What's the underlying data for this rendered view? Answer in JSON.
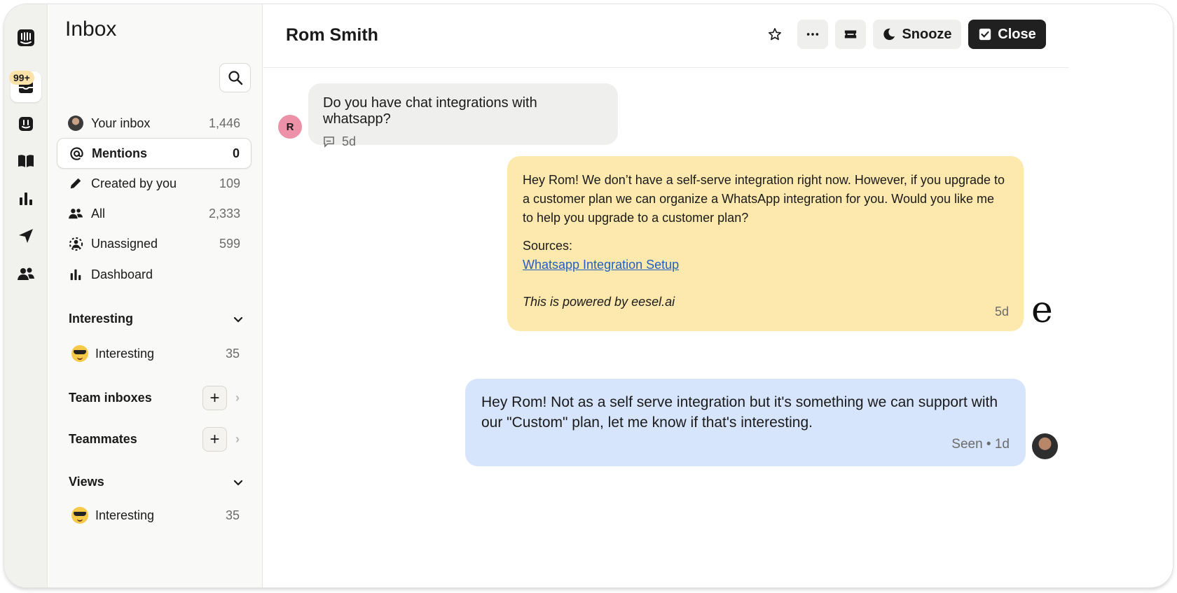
{
  "rail": {
    "badge": "99+",
    "items": [
      "intercom-logo-icon",
      "inbox-icon",
      "fin-icon",
      "knowledge-icon",
      "reports-icon",
      "outbound-icon",
      "contacts-icon"
    ]
  },
  "sidebar": {
    "title": "Inbox",
    "nav": [
      {
        "label": "Your inbox",
        "count": "1,446",
        "icon": "avatar"
      },
      {
        "label": "Mentions",
        "count": "0",
        "icon": "at-icon"
      },
      {
        "label": "Created by you",
        "count": "109",
        "icon": "pencil-icon"
      },
      {
        "label": "All",
        "count": "2,333",
        "icon": "people-icon"
      },
      {
        "label": "Unassigned",
        "count": "599",
        "icon": "unassigned-icon"
      },
      {
        "label": "Dashboard",
        "count": "",
        "icon": "bar-chart-icon"
      }
    ],
    "interesting_section": {
      "label": "Interesting",
      "item": {
        "label": "Interesting",
        "count": "35"
      }
    },
    "team_inboxes": {
      "label": "Team inboxes"
    },
    "teammates": {
      "label": "Teammates"
    },
    "views": {
      "label": "Views",
      "item": {
        "label": "Interesting",
        "count": "35"
      }
    }
  },
  "header": {
    "contact_name": "Rom Smith",
    "snooze_label": "Snooze",
    "close_label": "Close"
  },
  "conversation": {
    "incoming": {
      "avatar_initial": "R",
      "text": "Do you have chat integrations with whatsapp?",
      "time": "5d"
    },
    "ai_reply": {
      "text": "Hey Rom! We don’t have a self-serve integration right now. However, if you upgrade to a customer plan we can organize a WhatsApp integration for you. Would you like me to help you upgrade to a customer plan?",
      "sources_label": "Sources:",
      "link_text": "Whatsapp Integration Setup",
      "powered_by": "This is powered by eesel.ai",
      "time": "5d",
      "bot_mark": "e"
    },
    "outgoing": {
      "text": "Hey Rom! Not as a self serve integration but it's something we can support with our \"Custom\" plan, let me know if that's interesting.",
      "status": "Seen • 1d"
    }
  },
  "colors": {
    "ai_bubble": "#fde9ad",
    "agent_bubble": "#d7e5fc",
    "incoming_bubble": "#efefed",
    "close_button": "#202020",
    "link": "#1f5fc4",
    "avatar_r": "#ec91a8"
  }
}
